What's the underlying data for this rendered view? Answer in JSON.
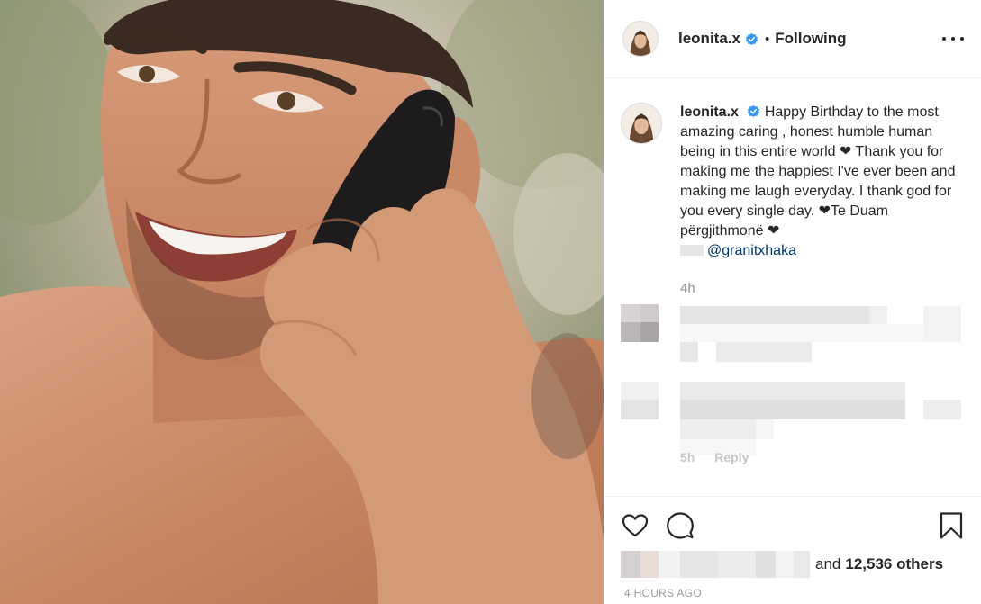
{
  "header": {
    "username": "leonita.x",
    "separator": "•",
    "follow_status": "Following"
  },
  "caption": {
    "username": "leonita.x",
    "text": "Happy Birthday to the most amazing caring , honest humble human being in this entire world ❤ Thank you for making me the happiest I've ever been and making me laugh everyday. I thank god for you every single day. ❤Te Duam përgjithmonë ❤",
    "mention": "@granitxhaka",
    "time": "4h"
  },
  "comment_meta": {
    "time": "5h",
    "reply_label": "Reply"
  },
  "likes": {
    "and_text": "and",
    "count_text": "12,536 others"
  },
  "post_time": "4 HOURS AGO",
  "icons": {
    "like": "heart-icon",
    "comment": "comment-bubble-icon",
    "save": "bookmark-icon",
    "more": "more-options-icon",
    "verified": "verified-badge-icon"
  },
  "colors": {
    "text": "#262626",
    "secondary": "#8e8e8e",
    "verified": "#3897f0",
    "mention": "#00376b"
  }
}
